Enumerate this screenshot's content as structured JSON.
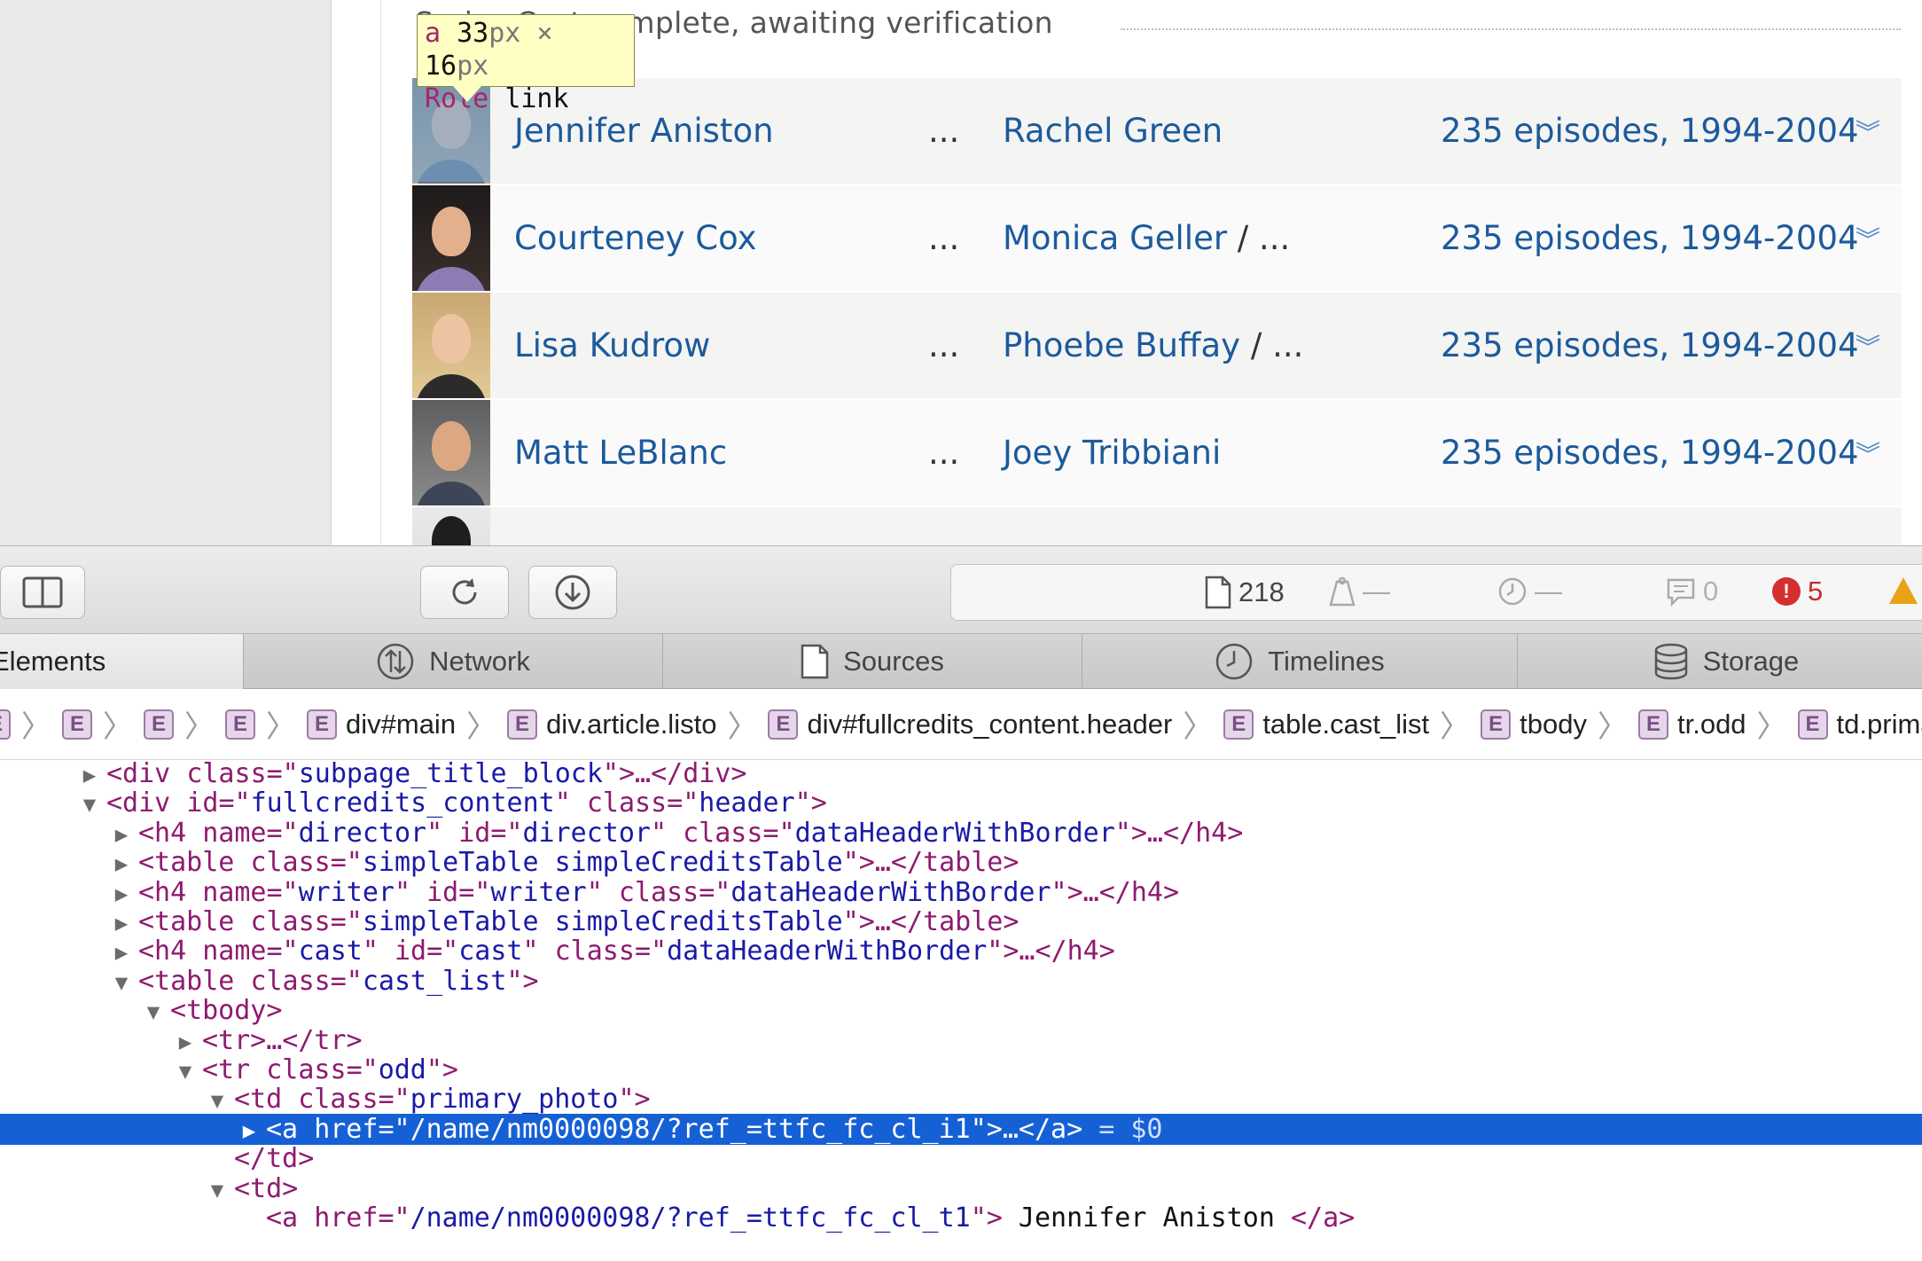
{
  "webpage": {
    "section_heading": "Series Cast complete, awaiting verification",
    "cast_rows": [
      {
        "name": "Jennifer Aniston",
        "ellipsis": "...",
        "character": "Rachel Green",
        "more": "",
        "episodes": "235 episodes, 1994-2004"
      },
      {
        "name": "Courteney Cox",
        "ellipsis": "...",
        "character": "Monica Geller",
        "more": " / ...",
        "episodes": "235 episodes, 1994-2004"
      },
      {
        "name": "Lisa Kudrow",
        "ellipsis": "...",
        "character": "Phoebe Buffay",
        "more": " / ...",
        "episodes": "235 episodes, 1994-2004"
      },
      {
        "name": "Matt LeBlanc",
        "ellipsis": "...",
        "character": "Joey Tribbiani",
        "more": "",
        "episodes": "235 episodes, 1994-2004"
      }
    ],
    "expand_icon": "double-chevron-down"
  },
  "tooltip": {
    "tag": "a",
    "width": "33",
    "height": "16",
    "unit": "px",
    "times": "×",
    "role_label": "Role",
    "role_value": "link"
  },
  "toolbar": {
    "resource_count": "218",
    "load_dash": "—",
    "time_dash": "—",
    "log_count": "0",
    "error_count": "5",
    "error_glyph": "!",
    "warning_glyph": "!"
  },
  "tabs": [
    {
      "label": "Elements",
      "icon": "elements-icon"
    },
    {
      "label": "Network",
      "icon": "network-icon"
    },
    {
      "label": "Sources",
      "icon": "document-icon"
    },
    {
      "label": "Timelines",
      "icon": "clock-icon"
    },
    {
      "label": "Storage",
      "icon": "database-icon"
    }
  ],
  "breadcrumb": {
    "badge": "E",
    "items": [
      "div#main",
      "div.article.listo",
      "div#fullcredits_content.header",
      "table.cast_list",
      "tbody",
      "tr.odd",
      "td.primar"
    ]
  },
  "dom_tree": {
    "nodes": [
      {
        "tri": "▶",
        "parts": [
          [
            "t",
            "<div "
          ],
          [
            "a",
            "class"
          ],
          [
            "t",
            "=\""
          ],
          [
            "v",
            "subpage_title_block"
          ],
          [
            "t",
            "\">…</div>"
          ]
        ]
      },
      {
        "tri": "▼",
        "parts": [
          [
            "t",
            "<div "
          ],
          [
            "a",
            "id"
          ],
          [
            "t",
            "=\""
          ],
          [
            "v",
            "fullcredits_content"
          ],
          [
            "t",
            "\" "
          ],
          [
            "a",
            "class"
          ],
          [
            "t",
            "=\""
          ],
          [
            "v",
            "header"
          ],
          [
            "t",
            "\">"
          ]
        ]
      },
      {
        "tri": "▶",
        "parts": [
          [
            "t",
            "<h4 "
          ],
          [
            "a",
            "name"
          ],
          [
            "t",
            "=\""
          ],
          [
            "v",
            "director"
          ],
          [
            "t",
            "\" "
          ],
          [
            "a",
            "id"
          ],
          [
            "t",
            "=\""
          ],
          [
            "v",
            "director"
          ],
          [
            "t",
            "\" "
          ],
          [
            "a",
            "class"
          ],
          [
            "t",
            "=\""
          ],
          [
            "v",
            "dataHeaderWithBorder"
          ],
          [
            "t",
            "\">…</h4>"
          ]
        ]
      },
      {
        "tri": "▶",
        "parts": [
          [
            "t",
            "<table "
          ],
          [
            "a",
            "class"
          ],
          [
            "t",
            "=\""
          ],
          [
            "v",
            "simpleTable simpleCreditsTable"
          ],
          [
            "t",
            "\">…</table>"
          ]
        ]
      },
      {
        "tri": "▶",
        "parts": [
          [
            "t",
            "<h4 "
          ],
          [
            "a",
            "name"
          ],
          [
            "t",
            "=\""
          ],
          [
            "v",
            "writer"
          ],
          [
            "t",
            "\" "
          ],
          [
            "a",
            "id"
          ],
          [
            "t",
            "=\""
          ],
          [
            "v",
            "writer"
          ],
          [
            "t",
            "\" "
          ],
          [
            "a",
            "class"
          ],
          [
            "t",
            "=\""
          ],
          [
            "v",
            "dataHeaderWithBorder"
          ],
          [
            "t",
            "\">…</h4>"
          ]
        ]
      },
      {
        "tri": "▶",
        "parts": [
          [
            "t",
            "<table "
          ],
          [
            "a",
            "class"
          ],
          [
            "t",
            "=\""
          ],
          [
            "v",
            "simpleTable simpleCreditsTable"
          ],
          [
            "t",
            "\">…</table>"
          ]
        ]
      },
      {
        "tri": "▶",
        "parts": [
          [
            "t",
            "<h4 "
          ],
          [
            "a",
            "name"
          ],
          [
            "t",
            "=\""
          ],
          [
            "v",
            "cast"
          ],
          [
            "t",
            "\" "
          ],
          [
            "a",
            "id"
          ],
          [
            "t",
            "=\""
          ],
          [
            "v",
            "cast"
          ],
          [
            "t",
            "\" "
          ],
          [
            "a",
            "class"
          ],
          [
            "t",
            "=\""
          ],
          [
            "v",
            "dataHeaderWithBorder"
          ],
          [
            "t",
            "\">…</h4>"
          ]
        ]
      },
      {
        "tri": "▼",
        "parts": [
          [
            "t",
            "<table "
          ],
          [
            "a",
            "class"
          ],
          [
            "t",
            "=\""
          ],
          [
            "v",
            "cast_list"
          ],
          [
            "t",
            "\">"
          ]
        ]
      },
      {
        "tri": "▼",
        "parts": [
          [
            "t",
            "<tbody>"
          ]
        ]
      },
      {
        "tri": "▶",
        "parts": [
          [
            "t",
            "<tr>…</tr>"
          ]
        ]
      },
      {
        "tri": "▼",
        "parts": [
          [
            "t",
            "<tr "
          ],
          [
            "a",
            "class"
          ],
          [
            "t",
            "=\""
          ],
          [
            "v",
            "odd"
          ],
          [
            "t",
            "\">"
          ]
        ]
      },
      {
        "tri": "▼",
        "parts": [
          [
            "t",
            "<td "
          ],
          [
            "a",
            "class"
          ],
          [
            "t",
            "=\""
          ],
          [
            "v",
            "primary_photo"
          ],
          [
            "t",
            "\">"
          ]
        ]
      },
      {
        "tri": "▶",
        "parts": [
          [
            "t",
            "<a "
          ],
          [
            "a",
            "href"
          ],
          [
            "t",
            "=\""
          ],
          [
            "v",
            "/name/nm0000098/?ref_=ttfc_fc_cl_i1"
          ],
          [
            "t",
            "\">…</a>"
          ],
          [
            "eq",
            " = $0"
          ]
        ],
        "selected": true
      },
      {
        "tri": "",
        "parts": [
          [
            "t",
            "</td>"
          ]
        ]
      },
      {
        "tri": "▼",
        "parts": [
          [
            "t",
            "<td>"
          ]
        ]
      },
      {
        "tri": "",
        "parts": [
          [
            "t",
            "<a "
          ],
          [
            "a",
            "href"
          ],
          [
            "t",
            "=\""
          ],
          [
            "v",
            "/name/nm0000098/?ref_=ttfc_fc_cl_t1"
          ],
          [
            "t",
            "\">"
          ],
          [
            "txt",
            " Jennifer Aniston "
          ],
          [
            "t",
            "</a>"
          ]
        ]
      }
    ]
  },
  "colors": {
    "link": "#1c5a9c",
    "selection": "#1660d6",
    "tag": "#8e1b6e",
    "attr_value": "#1a1aa6",
    "error": "#d42f2f",
    "warning": "#e8a317"
  }
}
